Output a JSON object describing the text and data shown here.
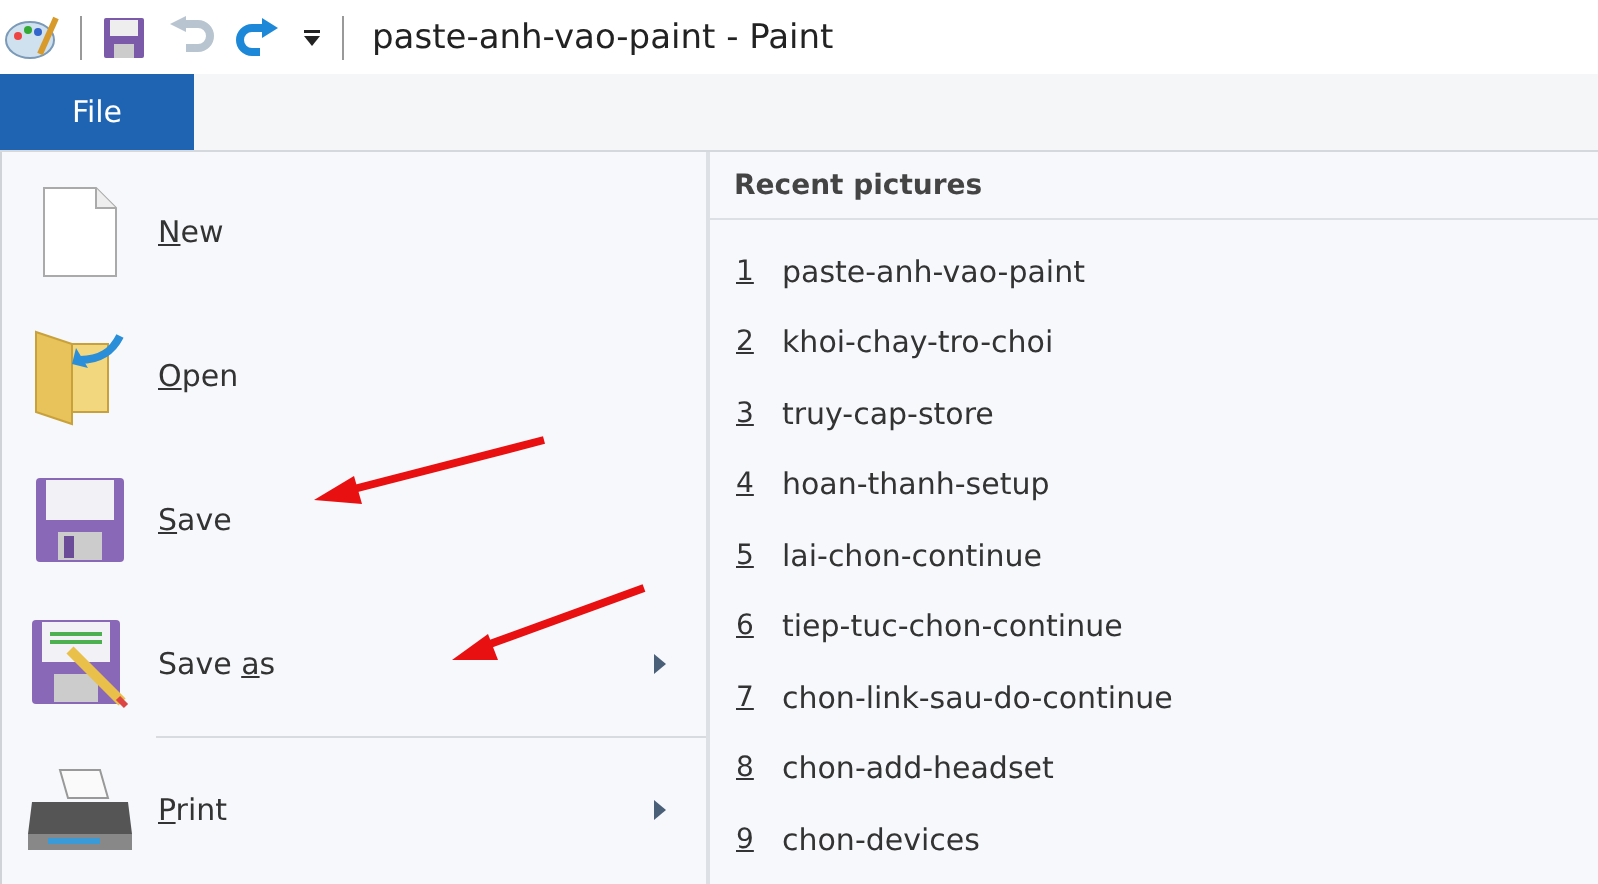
{
  "window": {
    "title": "paste-anh-vao-paint - Paint"
  },
  "menu_tab": {
    "label": "File",
    "selected": true
  },
  "file_menu": [
    {
      "kind": "new",
      "access_key": "N",
      "label_rest": "ew",
      "submenu": false
    },
    {
      "kind": "open",
      "access_key": "O",
      "label_rest": "pen",
      "submenu": false
    },
    {
      "kind": "save",
      "access_key": "S",
      "label_rest": "ave",
      "submenu": false
    },
    {
      "kind": "saveas",
      "label_start": "Save ",
      "access_key": "a",
      "label_rest": "s",
      "submenu": true,
      "separator_after": true
    },
    {
      "kind": "print",
      "access_key": "P",
      "label_rest": "rint",
      "submenu": true
    }
  ],
  "recent": {
    "heading": "Recent pictures",
    "items": [
      {
        "number": "1",
        "name": "paste-anh-vao-paint"
      },
      {
        "number": "2",
        "name": "khoi-chay-tro-choi"
      },
      {
        "number": "3",
        "name": "truy-cap-store"
      },
      {
        "number": "4",
        "name": "hoan-thanh-setup"
      },
      {
        "number": "5",
        "name": "lai-chon-continue"
      },
      {
        "number": "6",
        "name": "tiep-tuc-chon-continue"
      },
      {
        "number": "7",
        "name": "chon-link-sau-do-continue"
      },
      {
        "number": "8",
        "name": "chon-add-headset"
      },
      {
        "number": "9",
        "name": "chon-devices"
      }
    ]
  }
}
